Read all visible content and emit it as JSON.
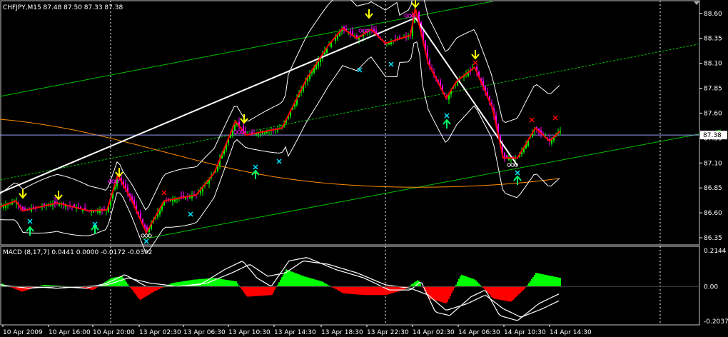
{
  "chart_data": {
    "type": "candlestick",
    "symbol_header": "CHFJPY,M15",
    "ohlc_header": "87.48 87.50 87.33 87.38",
    "current_price_label": "87.38",
    "x_ticks": [
      "10 Apr 2009",
      "10 Apr 16:00",
      "10 Apr 20:00",
      "13 Apr 02:30",
      "13 Apr 06:30",
      "13 Apr 10:30",
      "13 Apr 14:30",
      "13 Apr 18:30",
      "13 Apr 22:30",
      "14 Apr 02:30",
      "14 Apr 06:30",
      "14 Apr 10:30",
      "14 Apr 14:30"
    ],
    "price_ticks": [
      "88.60",
      "88.35",
      "88.10",
      "87.85",
      "87.60",
      "87.35",
      "87.10",
      "86.85",
      "86.60",
      "86.35"
    ],
    "price_range": [
      86.3,
      88.72
    ],
    "price_path": [
      [
        0,
        86.66
      ],
      [
        22,
        86.72
      ],
      [
        32,
        86.62
      ],
      [
        80,
        86.7
      ],
      [
        125,
        86.62
      ],
      [
        150,
        86.63
      ],
      [
        165,
        86.98
      ],
      [
        185,
        86.72
      ],
      [
        205,
        86.4
      ],
      [
        230,
        86.72
      ],
      [
        275,
        86.78
      ],
      [
        300,
        87.0
      ],
      [
        330,
        87.52
      ],
      [
        345,
        87.38
      ],
      [
        395,
        87.45
      ],
      [
        430,
        87.95
      ],
      [
        460,
        88.28
      ],
      [
        480,
        88.45
      ],
      [
        500,
        88.35
      ],
      [
        520,
        88.44
      ],
      [
        540,
        88.3
      ],
      [
        575,
        88.38
      ],
      [
        582,
        88.65
      ],
      [
        600,
        88.1
      ],
      [
        625,
        87.75
      ],
      [
        640,
        87.92
      ],
      [
        665,
        88.06
      ],
      [
        690,
        87.65
      ],
      [
        705,
        87.15
      ],
      [
        725,
        87.15
      ],
      [
        750,
        87.45
      ],
      [
        770,
        87.32
      ],
      [
        785,
        87.42
      ]
    ],
    "indicators": {
      "macd_label": "MACD (8,17,7) 0.0441 0.0000 -0.0172 -0.0392",
      "macd_ticks": [
        "0.2144",
        "0.00",
        "-0.2037"
      ],
      "macd_range": [
        -0.2037,
        0.2144
      ],
      "macd_histogram": [
        [
          0,
          0.02
        ],
        [
          30,
          -0.03
        ],
        [
          60,
          0.01
        ],
        [
          100,
          0.0
        ],
        [
          130,
          -0.02
        ],
        [
          155,
          0.05
        ],
        [
          170,
          0.06
        ],
        [
          195,
          -0.08
        ],
        [
          215,
          -0.03
        ],
        [
          240,
          0.02
        ],
        [
          270,
          0.04
        ],
        [
          300,
          0.05
        ],
        [
          330,
          0.03
        ],
        [
          345,
          -0.06
        ],
        [
          380,
          -0.05
        ],
        [
          400,
          0.1
        ],
        [
          425,
          0.06
        ],
        [
          450,
          0.03
        ],
        [
          480,
          -0.04
        ],
        [
          510,
          -0.05
        ],
        [
          540,
          -0.05
        ],
        [
          565,
          -0.02
        ],
        [
          585,
          0.04
        ],
        [
          600,
          -0.07
        ],
        [
          625,
          -0.1
        ],
        [
          645,
          0.07
        ],
        [
          665,
          0.04
        ],
        [
          690,
          -0.07
        ],
        [
          715,
          -0.09
        ],
        [
          735,
          -0.01
        ],
        [
          750,
          0.08
        ],
        [
          785,
          0.05
        ]
      ],
      "macd_line": [
        [
          0,
          0.01
        ],
        [
          40,
          -0.01
        ],
        [
          80,
          0.0
        ],
        [
          120,
          -0.01
        ],
        [
          150,
          0.02
        ],
        [
          175,
          0.07
        ],
        [
          205,
          0.0
        ],
        [
          240,
          0.0
        ],
        [
          280,
          0.01
        ],
        [
          315,
          0.1
        ],
        [
          340,
          0.15
        ],
        [
          360,
          0.05
        ],
        [
          380,
          0.0
        ],
        [
          405,
          0.15
        ],
        [
          430,
          0.17
        ],
        [
          470,
          0.1
        ],
        [
          510,
          0.05
        ],
        [
          545,
          -0.02
        ],
        [
          575,
          -0.02
        ],
        [
          590,
          0.03
        ],
        [
          610,
          -0.15
        ],
        [
          630,
          -0.17
        ],
        [
          660,
          -0.06
        ],
        [
          680,
          -0.02
        ],
        [
          700,
          -0.17
        ],
        [
          725,
          -0.2
        ],
        [
          755,
          -0.1
        ],
        [
          785,
          -0.04
        ]
      ],
      "signal_line": [
        [
          0,
          0.0
        ],
        [
          40,
          0.0
        ],
        [
          80,
          -0.01
        ],
        [
          120,
          0.0
        ],
        [
          150,
          0.01
        ],
        [
          180,
          0.05
        ],
        [
          210,
          0.02
        ],
        [
          250,
          0.0
        ],
        [
          290,
          0.02
        ],
        [
          325,
          0.08
        ],
        [
          350,
          0.13
        ],
        [
          375,
          0.06
        ],
        [
          400,
          0.08
        ],
        [
          425,
          0.15
        ],
        [
          460,
          0.13
        ],
        [
          500,
          0.08
        ],
        [
          540,
          0.01
        ],
        [
          575,
          -0.01
        ],
        [
          600,
          -0.05
        ],
        [
          625,
          -0.14
        ],
        [
          655,
          -0.1
        ],
        [
          680,
          -0.05
        ],
        [
          705,
          -0.13
        ],
        [
          730,
          -0.18
        ],
        [
          760,
          -0.13
        ],
        [
          785,
          -0.08
        ]
      ]
    },
    "grid": true,
    "colors": {
      "background": "#000000",
      "up_candle": "#00ff00",
      "down_candle": "#ff00ff",
      "zigzag": "#ff0000",
      "trendline": "#ffffff",
      "channel": "#00c000",
      "moving_average": "#ff8c00",
      "bands": "#ffffff",
      "macd_positive": "#00ff00",
      "macd_negative": "#ff0000",
      "arrow_down": "#ffff00",
      "arrow_up": "#00ff66",
      "marker_cross": "#00e5ff",
      "marker_red": "#ff0000",
      "marker_circle_magenta": "#ff00ff"
    }
  }
}
